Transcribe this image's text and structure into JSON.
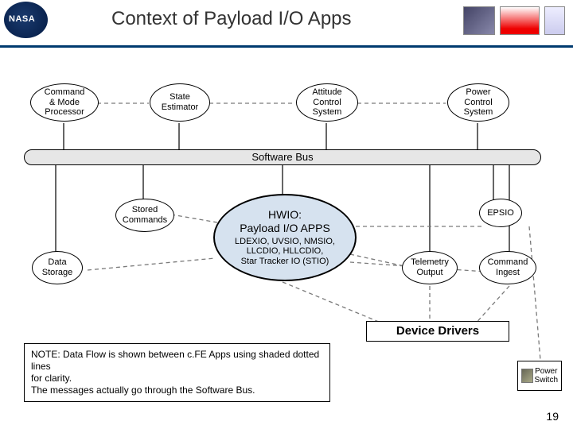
{
  "header": {
    "title": "Context of Payload I/O Apps",
    "logo_text": "NASA"
  },
  "nodes": {
    "cmd_mode": "Command\n& Mode\nProcessor",
    "state_est": "State\nEstimator",
    "att_ctrl": "Attitude\nControl\nSystem",
    "pwr_ctrl": "Power\nControl\nSystem",
    "sw_bus": "Software Bus",
    "stored_cmds": "Stored\nCommands",
    "hwio_title": "HWIO:\nPayload I/O APPS",
    "hwio_sub": "LDEXIO, UVSIO, NMSIO,\nLLCDIO, HLLCDIO,\nStar Tracker IO (STIO)",
    "epsio": "EPSIO",
    "data_storage": "Data\nStorage",
    "telemetry": "Telemetry\nOutput",
    "cmd_ingest": "Command\nIngest",
    "device_drivers": "Device Drivers",
    "power_switch": "Power\nSwitch"
  },
  "note": "NOTE: Data Flow is shown between c.FE Apps using shaded dotted lines\nfor clarity.\nThe messages actually go through the Software Bus.",
  "page_number": "19",
  "colors": {
    "bus_fill": "#e6e6e6",
    "hwio_fill": "#d6e2ef",
    "line": "#333333",
    "dash": "#7a7a7a"
  }
}
